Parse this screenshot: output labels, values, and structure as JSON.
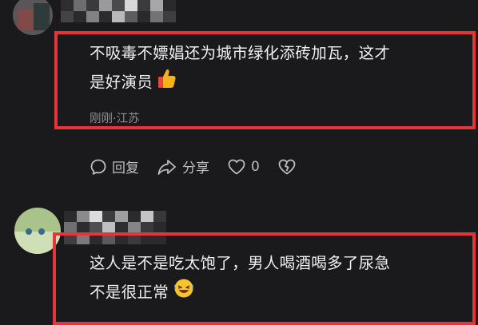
{
  "comments": [
    {
      "text_line1": "不吸毒不嫖娼还为城市绿化添砖加瓦，这才",
      "text_line2": "是好演员",
      "emoji": "thumbs-up",
      "meta": "刚刚·江苏",
      "actions": {
        "reply": "回复",
        "share": "分享",
        "like_count": "0"
      }
    },
    {
      "text_line1": "这人是不是吃太饱了，男人喝酒喝多了尿急",
      "text_line2": "不是很正常",
      "emoji": "rofl"
    }
  ],
  "colors": {
    "background": "#1a1a1c",
    "highlight": "#e8333a",
    "meta_text": "#8d8d90"
  }
}
